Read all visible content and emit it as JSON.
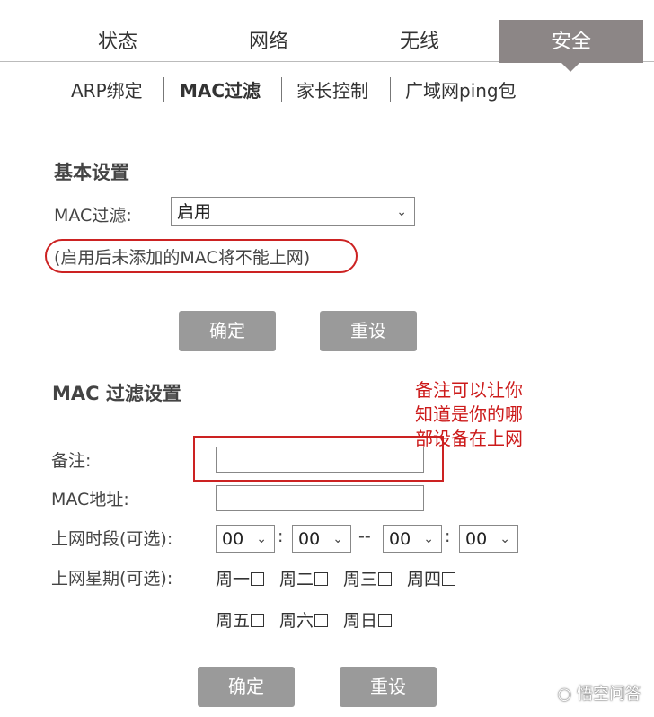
{
  "tabs": [
    {
      "label": "状态"
    },
    {
      "label": "网络"
    },
    {
      "label": "无线"
    },
    {
      "label": "安全",
      "active": true
    }
  ],
  "subnav": [
    {
      "label": "ARP绑定"
    },
    {
      "label": "MAC过滤",
      "active": true
    },
    {
      "label": "家长控制"
    },
    {
      "label": "广域网ping包"
    }
  ],
  "basic": {
    "heading": "基本设置",
    "mac_filter_label": "MAC过滤:",
    "mac_filter_value": "启用",
    "hint": "(启用后未添加的MAC将不能上网)",
    "confirm": "确定",
    "reset": "重设"
  },
  "filter": {
    "heading": "MAC 过滤设置",
    "note_label": "备注:",
    "mac_label": "MAC地址:",
    "time_label": "上网时段(可选):",
    "week_label": "上网星期(可选):",
    "time_values": [
      "00",
      "00",
      "00",
      "00"
    ],
    "colon": ":",
    "dash": "--",
    "days": [
      "周一",
      "周二",
      "周三",
      "周四",
      "周五",
      "周六",
      "周日"
    ],
    "confirm": "确定",
    "reset": "重设"
  },
  "annotation": {
    "lines": [
      "备注可以让你",
      "知道是你的哪",
      "部设备在上网"
    ],
    "color": "#cc1a1a"
  },
  "watermark": "悟空问答",
  "colors": {
    "tab_active": "#8c8686",
    "button": "#9a9a9a"
  }
}
